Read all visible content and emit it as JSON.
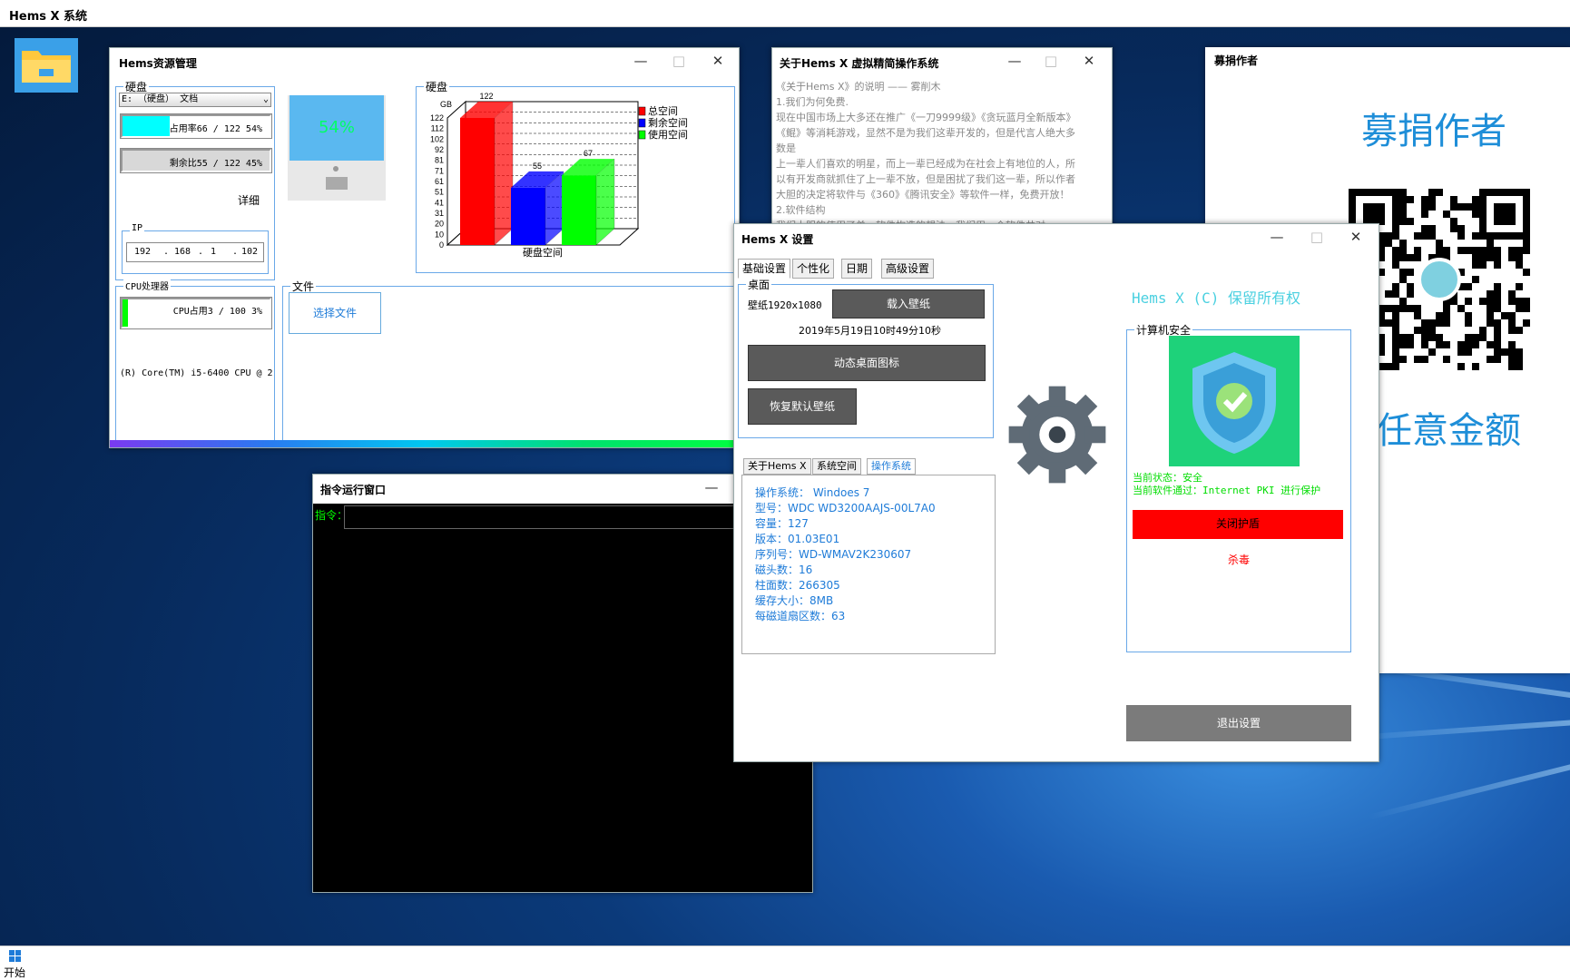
{
  "app_title": "Hems X 系统",
  "taskbar": {
    "start_label": "开始"
  },
  "resource_win": {
    "title": "Hems资源管理",
    "disk_group": "硬盘",
    "disk_select": "E: （硬盘） 文档",
    "used_label": "占用率66  /  122   54%",
    "used_pct": 54,
    "free_label": "剩余比55  /  122   45%",
    "detail_label": "详细",
    "ip_group": "IP",
    "ip": [
      "192",
      "168",
      "1",
      "102"
    ],
    "monitor_pct": "54%",
    "cpu_group": "CPU处理器",
    "cpu_label": "CPU占用3  /  100   3%",
    "cpu_pct": 3,
    "cpu_model": "(R) Core(TM) i5-6400 CPU @ 2.",
    "file_group": "文件",
    "file_button": "选择文件",
    "chart_group": "硬盘"
  },
  "chart_data": {
    "type": "bar",
    "title": "",
    "ylabel": "GB",
    "xlabel": "硬盘空间",
    "yticks": [
      "122",
      "112",
      "102",
      "92",
      "81",
      "71",
      "61",
      "51",
      "41",
      "31",
      "20",
      "10",
      "0"
    ],
    "ylim": [
      0,
      122
    ],
    "series": [
      {
        "name": "总空间",
        "value": 122,
        "color": "#ff0000"
      },
      {
        "name": "剩余空间",
        "value": 55,
        "color": "#0000ff"
      },
      {
        "name": "使用空间",
        "value": 67,
        "color": "#00ff00"
      }
    ]
  },
  "about_win": {
    "title": "关于Hems X 虚拟精简操作系统",
    "lines": [
      "《关于Hems X》的说明    —— 雾削木",
      "1.我们为何免费.",
      "现在中国市场上大多还在推广《一刀9999级》《贪玩蓝月全新版本》",
      "《鲲》等消耗游戏，显然不是为我们这辈开发的，但是代言人绝大多",
      "数是",
      "上一辈人们喜欢的明星，而上一辈已经成为在社会上有地位的人，所",
      "以有开发商就抓住了上一辈不放，但是困扰了我们这一辈，所以作者",
      "大胆的决定将软件与《360》《腾讯安全》等软件一样，免费开放！",
      "2.软件结构",
      "我们大胆的使用了单一软件构造的想法，我们用一个软件共对"
    ]
  },
  "donate_win": {
    "title": "募捐作者",
    "heading": "募捐作者",
    "footer": "任意金额"
  },
  "cmd_win": {
    "title": "指令运行窗口",
    "prompt": "指令："
  },
  "settings_win": {
    "title": "Hems X 设置",
    "tabs": [
      "基础设置",
      "个性化",
      "日期",
      "高级设置"
    ],
    "desktop_group": "桌面",
    "wallpaper_label": "壁纸1920x1080",
    "load_wallpaper": "载入壁纸",
    "datetime": "2019年5月19日10时49分10秒",
    "dynamic_icon": "动态桌面图标",
    "restore_wallpaper": "恢复默认壁纸",
    "sub_tabs": [
      "关于Hems X",
      "系统空间",
      "操作系统"
    ],
    "os_info": [
      "操作系统：  Windoes 7",
      "型号：WDC WD3200AAJS-00L7A0",
      "容量：127",
      "版本：01.03E01",
      "序列号：WD-WMAV2K230607",
      "磁头数：16",
      "柱面数：266305",
      "缓存大小：8MB",
      "每磁道扇区数：63"
    ],
    "copyright": "Hems X (C) 保留所有权",
    "security_group": "计算机安全",
    "status_line": "当前状态：安全",
    "protect_line": "当前软件通过：Internet PKI 进行保护",
    "close_shield": "关闭护盾",
    "antivirus": "杀毒",
    "exit_settings": "退出设置"
  },
  "colors": {
    "accent": "#1e7bd8",
    "green": "#00dd00",
    "red": "#ff0000",
    "cyan": "#00ffff"
  }
}
